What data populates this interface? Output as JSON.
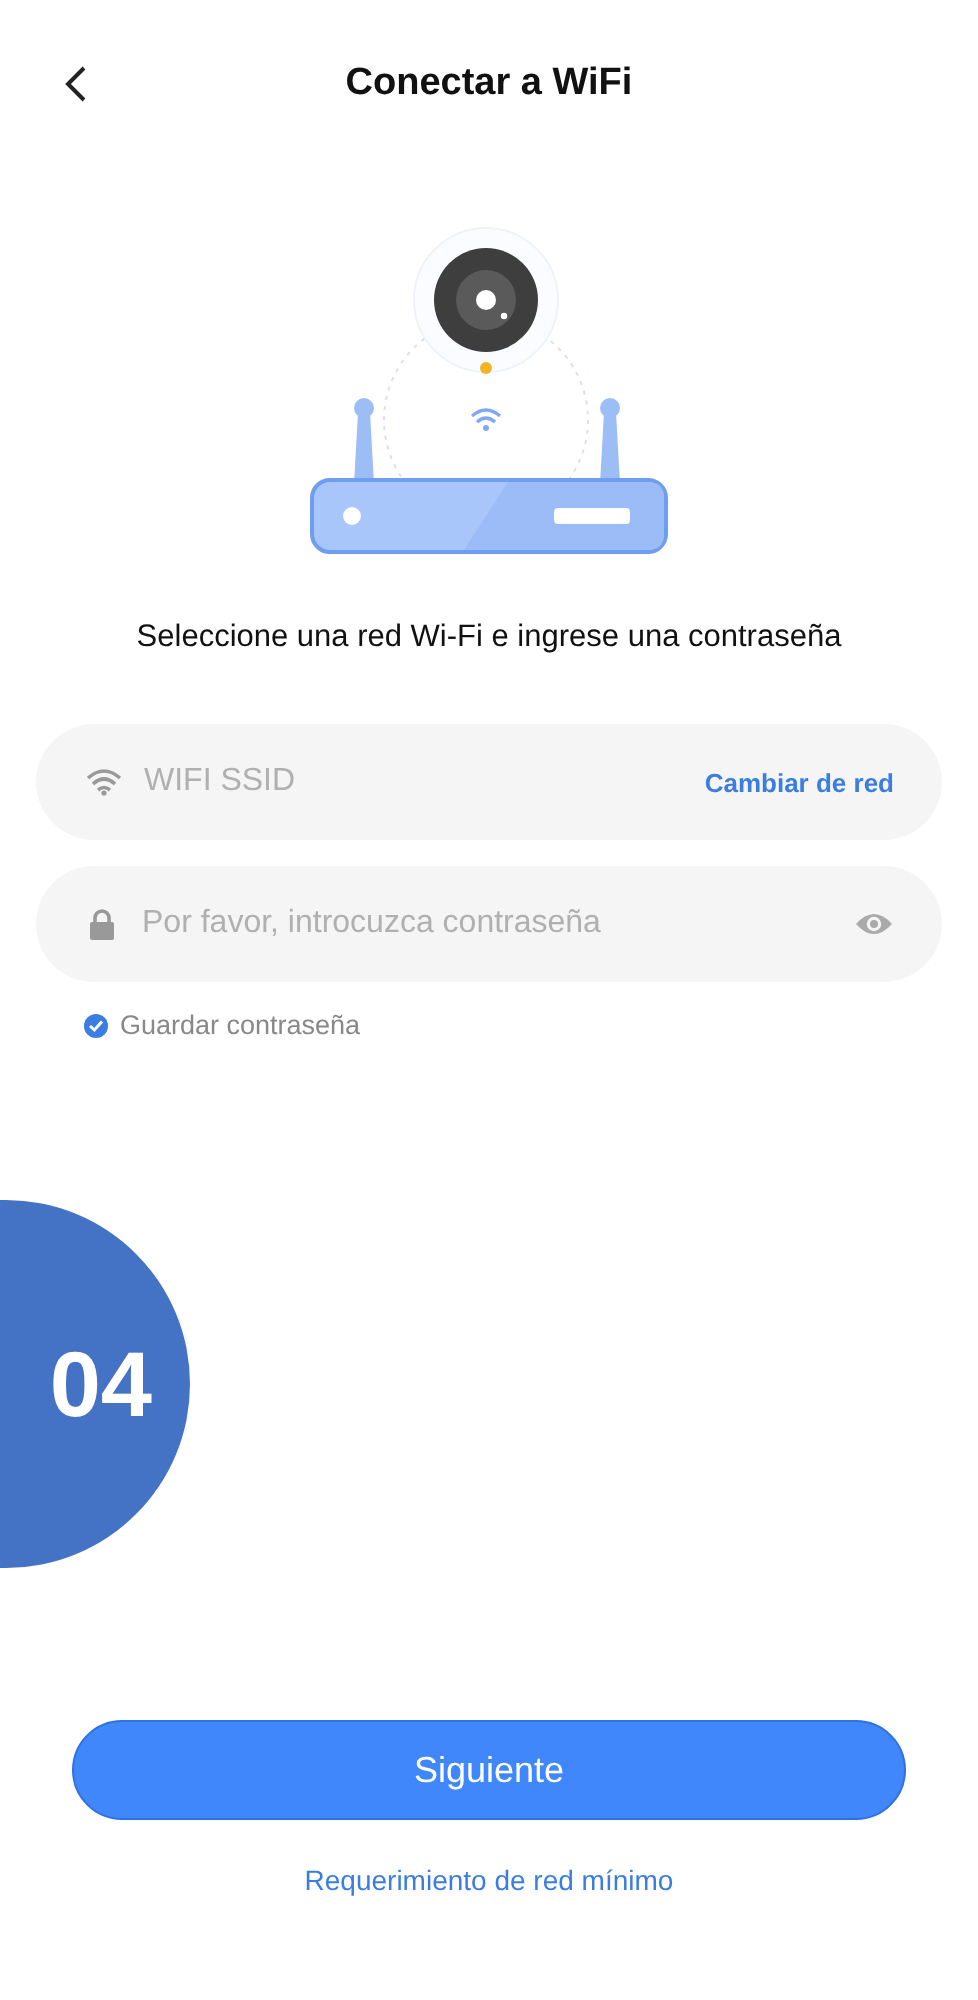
{
  "header": {
    "title": "Conectar a WiFi"
  },
  "instruction": "Seleccione una red Wi-Fi e ingrese una contraseña",
  "ssid_field": {
    "placeholder": "WIFI SSID",
    "action": "Cambiar de red"
  },
  "password_field": {
    "placeholder": "Por favor, introcuzca contraseña"
  },
  "save_password": {
    "label": "Guardar contraseña",
    "checked": true
  },
  "step_badge": "04",
  "next_button": "Siguiente",
  "requirements_link": "Requerimiento de red mínimo"
}
